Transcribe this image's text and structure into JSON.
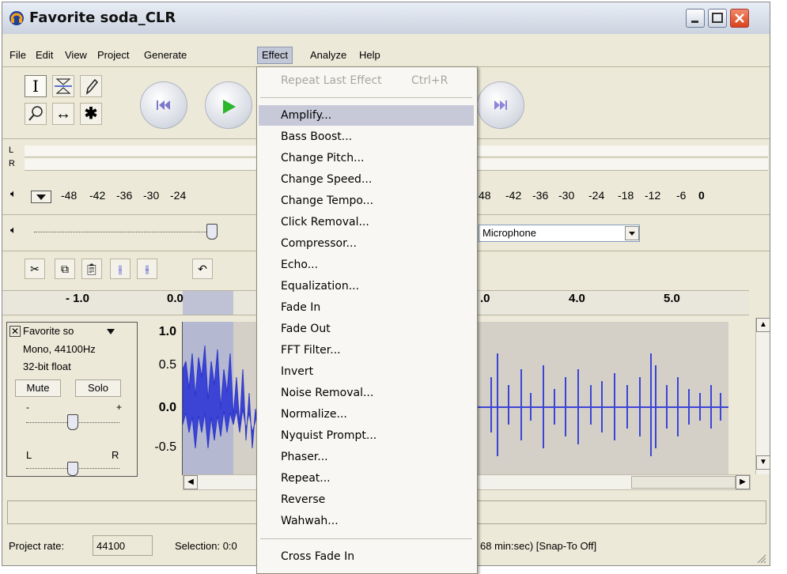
{
  "window": {
    "title": "Favorite soda_CLR"
  },
  "menubar": [
    "File",
    "Edit",
    "View",
    "Project",
    "Generate",
    "Effect",
    "Analyze",
    "Help"
  ],
  "meter": {
    "left_label": "L",
    "right_label": "R",
    "scale_left": [
      "-48",
      "-42",
      "-36",
      "-30",
      "-24"
    ],
    "scale_right": [
      "48",
      "-42",
      "-36",
      "-30",
      "-24",
      "-18",
      "-12",
      "-6",
      "0"
    ]
  },
  "input_source": {
    "value": "Microphone"
  },
  "ruler": {
    "ticks": [
      "- 1.0",
      "0.0",
      ".0",
      "4.0",
      "5.0"
    ]
  },
  "track": {
    "name": "Favorite so",
    "format": "Mono, 44100Hz",
    "bitdepth": "32-bit float",
    "mute_label": "Mute",
    "solo_label": "Solo",
    "gain_minus": "-",
    "gain_plus": "+",
    "pan_left": "L",
    "pan_right": "R"
  },
  "vertical_scale": [
    "1.0",
    "0.5",
    "0.0",
    "-0.5"
  ],
  "status": {
    "project_rate_label": "Project rate:",
    "project_rate_value": "44100",
    "selection_text": "Selection: 0:0",
    "right_text": "68 min:sec)  [Snap-To Off]"
  },
  "effect_menu": {
    "repeat_label": "Repeat Last Effect",
    "repeat_shortcut": "Ctrl+R",
    "items": [
      "Amplify...",
      "Bass Boost...",
      "Change Pitch...",
      "Change Speed...",
      "Change Tempo...",
      "Click Removal...",
      "Compressor...",
      "Echo...",
      "Equalization...",
      "Fade In",
      "Fade Out",
      "FFT Filter...",
      "Invert",
      "Noise Removal...",
      "Normalize...",
      "Nyquist Prompt...",
      "Phaser...",
      "Repeat...",
      "Reverse",
      "Wahwah..."
    ],
    "after_separator": [
      "Cross Fade In"
    ]
  }
}
